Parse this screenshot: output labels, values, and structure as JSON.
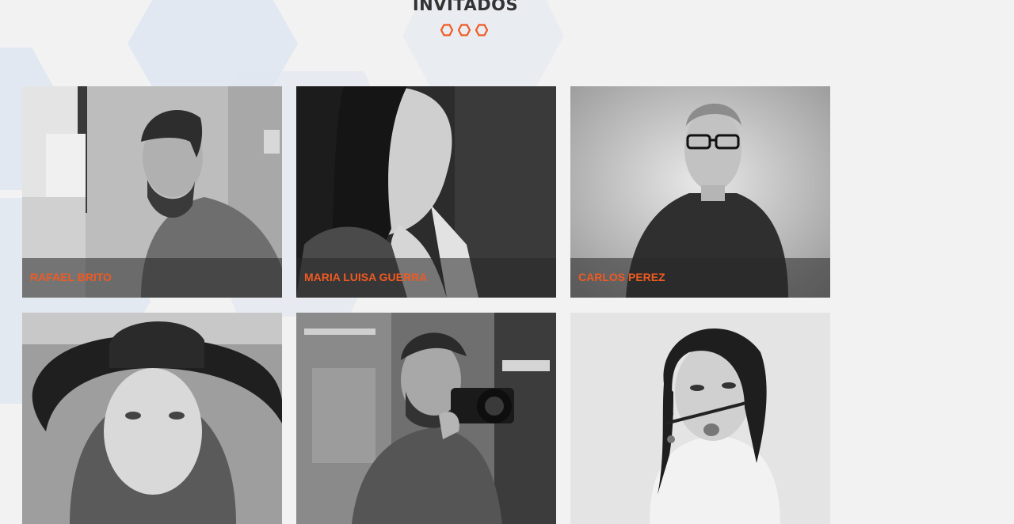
{
  "section": {
    "title": "INVITADOS",
    "accent_color": "#f05a22",
    "divider_icon": "hexagon-icon"
  },
  "guests": [
    {
      "name": "RAFAEL BRITO",
      "photo": "man-with-beard-at-desk"
    },
    {
      "name": "MARIA LUISA GUERRA",
      "photo": "woman-profile-hand-near-face"
    },
    {
      "name": "CARLOS PEREZ",
      "photo": "man-with-glasses-polo-shirt"
    },
    {
      "name": "",
      "photo": "woman-with-wide-brim-hat"
    },
    {
      "name": "",
      "photo": "man-holding-camera"
    },
    {
      "name": "",
      "photo": "woman-with-pencil-mustache"
    }
  ]
}
